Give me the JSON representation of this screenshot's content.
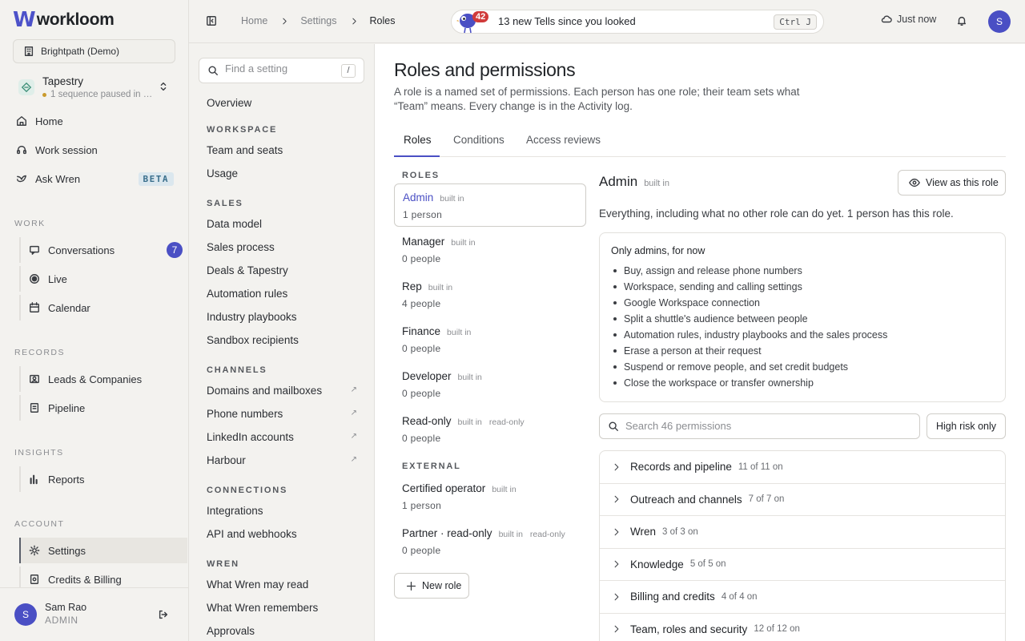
{
  "brand": {
    "logo_mark": "W",
    "name": "workloom"
  },
  "sidebar": {
    "org": "Brightpath (Demo)",
    "tapestry": {
      "name": "Tapestry",
      "status": "1 sequence paused in …"
    },
    "top_items": [
      {
        "label": "Home",
        "icon": "home-icon"
      },
      {
        "label": "Work session",
        "icon": "headset-icon"
      },
      {
        "label": "Ask Wren",
        "icon": "bird-icon",
        "badge": "BETA"
      }
    ],
    "sections": {
      "work": "WORK",
      "records": "RECORDS",
      "insights": "INSIGHTS",
      "account": "ACCOUNT"
    },
    "work_items": [
      {
        "label": "Conversations",
        "icon": "chat-icon",
        "count": "7"
      },
      {
        "label": "Live",
        "icon": "live-icon"
      },
      {
        "label": "Calendar",
        "icon": "calendar-icon"
      }
    ],
    "records_items": [
      {
        "label": "Leads & Companies",
        "icon": "contacts-icon"
      },
      {
        "label": "Pipeline",
        "icon": "pipeline-icon"
      }
    ],
    "insights_items": [
      {
        "label": "Reports",
        "icon": "bar-chart-icon"
      }
    ],
    "account_items": [
      {
        "label": "Settings",
        "icon": "gear-icon",
        "active": true
      },
      {
        "label": "Credits & Billing",
        "icon": "billing-icon"
      }
    ],
    "user": {
      "initial": "S",
      "name": "Sam Rao",
      "role": "ADMIN"
    }
  },
  "topbar": {
    "breadcrumb": [
      "Home",
      "Settings",
      "Roles"
    ],
    "notice": {
      "badge": "42",
      "text": "13 new Tells since you looked",
      "shortcut": "Ctrl J"
    },
    "sync_status": "Just now",
    "avatar_initial": "S"
  },
  "settings_nav": {
    "search_placeholder": "Find a setting",
    "search_shortcut": "/",
    "overview": "Overview",
    "sections": [
      {
        "title": "WORKSPACE",
        "items": [
          "Team and seats",
          "Usage"
        ]
      },
      {
        "title": "SALES",
        "items": [
          "Data model",
          "Sales process",
          "Deals & Tapestry",
          "Automation rules",
          "Industry playbooks",
          "Sandbox recipients"
        ]
      },
      {
        "title": "CHANNELS",
        "items": [
          "Domains and mailboxes",
          "Phone numbers",
          "LinkedIn accounts",
          "Harbour"
        ]
      },
      {
        "title": "CONNECTIONS",
        "items": [
          "Integrations",
          "API and webhooks"
        ]
      },
      {
        "title": "WREN",
        "items": [
          "What Wren may read",
          "What Wren remembers",
          "Approvals"
        ]
      }
    ],
    "external_marker": "↗"
  },
  "main": {
    "title": "Roles and permissions",
    "description": "A role is a named set of permissions. Each person has one role; their team sets what “Team” means. Every change is in the Activity log.",
    "tabs": [
      "Roles",
      "Conditions",
      "Access reviews"
    ],
    "roles_heading": "ROLES",
    "external_heading": "EXTERNAL",
    "roles": [
      {
        "name": "Admin",
        "tag": "built in",
        "count": "1 person"
      },
      {
        "name": "Manager",
        "tag": "built in",
        "count": "0 people"
      },
      {
        "name": "Rep",
        "tag": "built in",
        "count": "4 people"
      },
      {
        "name": "Finance",
        "tag": "built in",
        "count": "0 people"
      },
      {
        "name": "Developer",
        "tag": "built in",
        "count": "0 people"
      },
      {
        "name": "Read-only",
        "tag": "built in",
        "tag2": "read-only",
        "count": "0 people"
      }
    ],
    "external_roles": [
      {
        "name": "Certified operator",
        "tag": "built in",
        "count": "1 person"
      },
      {
        "name": "Partner · read-only",
        "tag": "built in",
        "tag2": "read-only",
        "count": "0 people"
      }
    ],
    "new_role_label": "New role",
    "detail": {
      "title": "Admin",
      "tag": "built in",
      "view_as_label": "View as this role",
      "description": "Everything, including what no other role can do yet. 1 person has this role.",
      "admins_only_title": "Only admins, for now",
      "admins_only_items": [
        "Buy, assign and release phone numbers",
        "Workspace, sending and calling settings",
        "Google Workspace connection",
        "Split a shuttle's audience between people",
        "Automation rules, industry playbooks and the sales process",
        "Erase a person at their request",
        "Suspend or remove people, and set credit budgets",
        "Close the workspace or transfer ownership"
      ],
      "permission_search_placeholder": "Search 46 permissions",
      "high_risk_label": "High risk only",
      "groups": [
        {
          "name": "Records and pipeline",
          "count": "11 of 11 on"
        },
        {
          "name": "Outreach and channels",
          "count": "7 of 7 on"
        },
        {
          "name": "Wren",
          "count": "3 of 3 on"
        },
        {
          "name": "Knowledge",
          "count": "5 of 5 on"
        },
        {
          "name": "Billing and credits",
          "count": "4 of 4 on"
        },
        {
          "name": "Team, roles and security",
          "count": "12 of 12 on"
        }
      ]
    }
  },
  "colors": {
    "accent": "#4a4fc4",
    "badge_red": "#d03a3a",
    "background": "#f3f2ef"
  }
}
